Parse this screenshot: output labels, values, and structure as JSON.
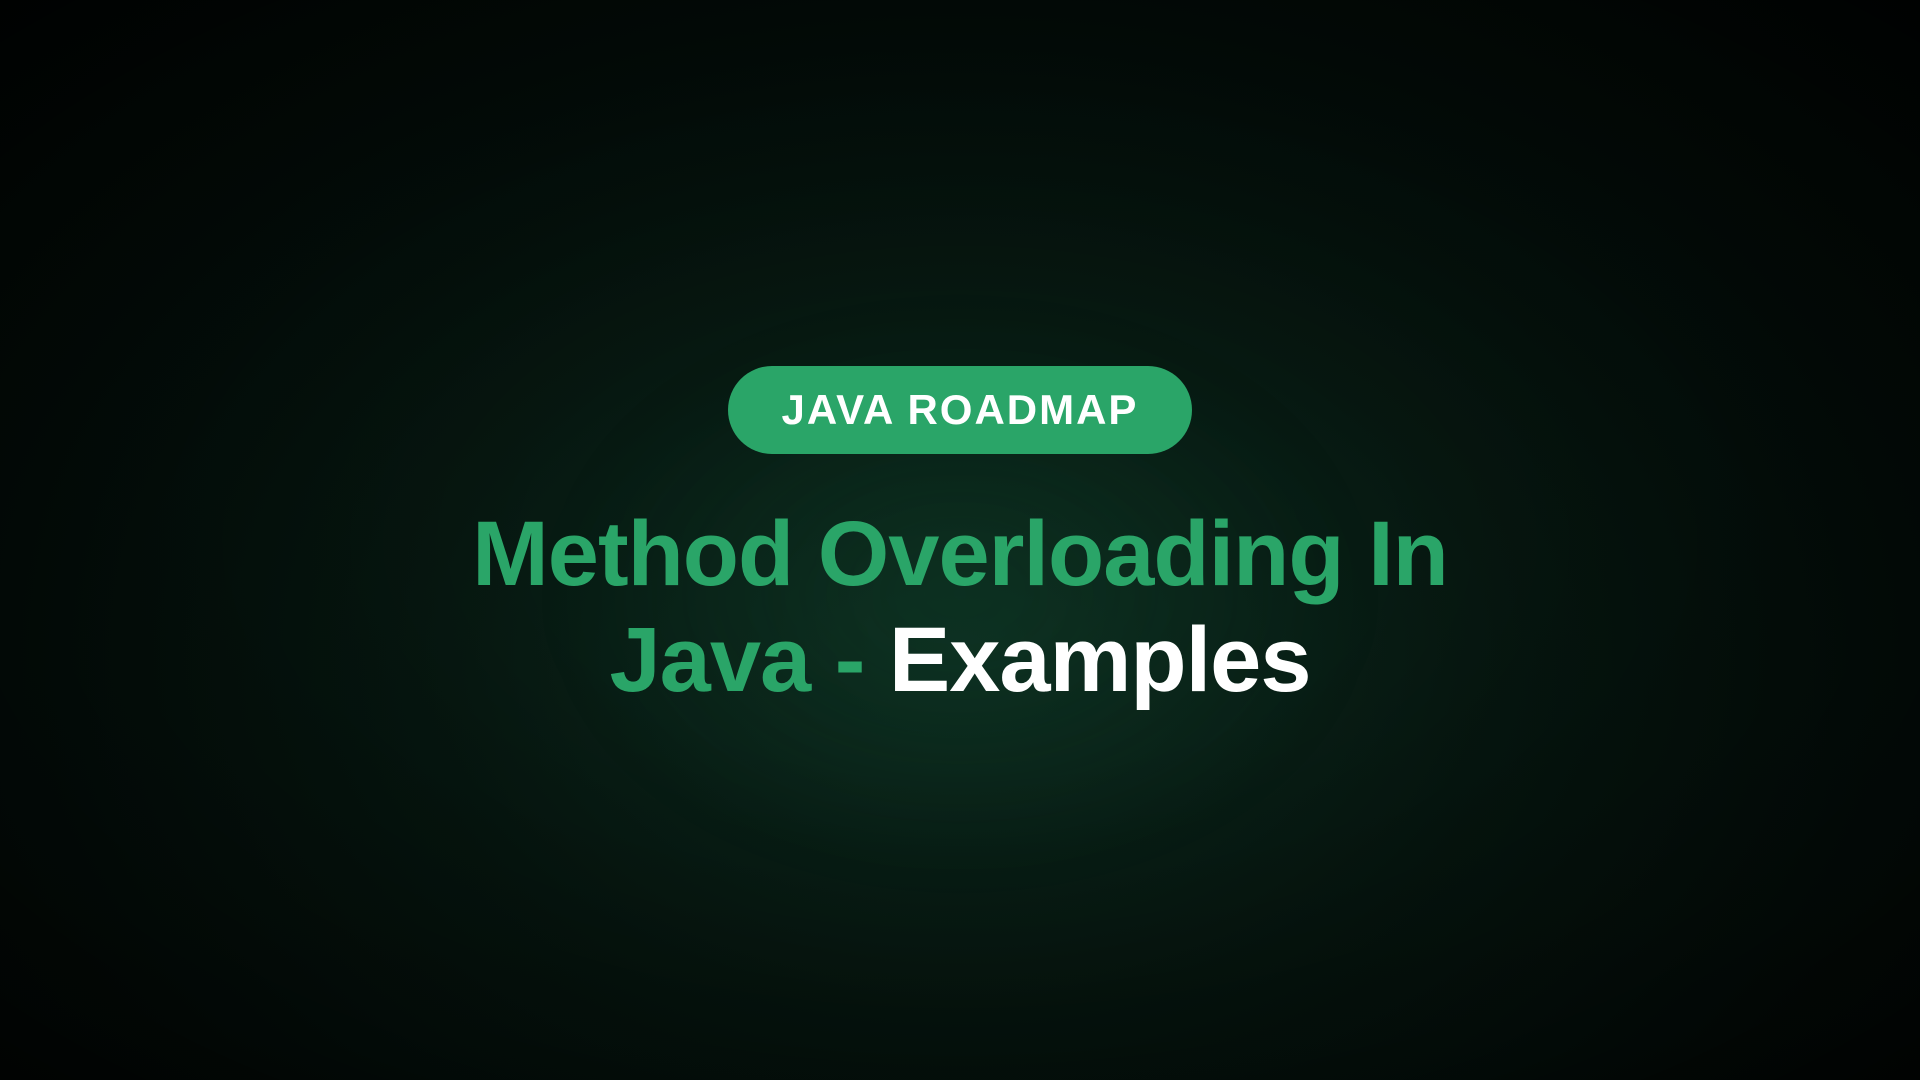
{
  "badge": {
    "label": "JAVA ROADMAP"
  },
  "title": {
    "line1": "Method Overloading In",
    "line2_green": "Java - ",
    "line2_white": "Examples"
  },
  "colors": {
    "accent_green": "#2aa568",
    "text_white": "#ffffff",
    "bg_dark": "#030d09"
  }
}
